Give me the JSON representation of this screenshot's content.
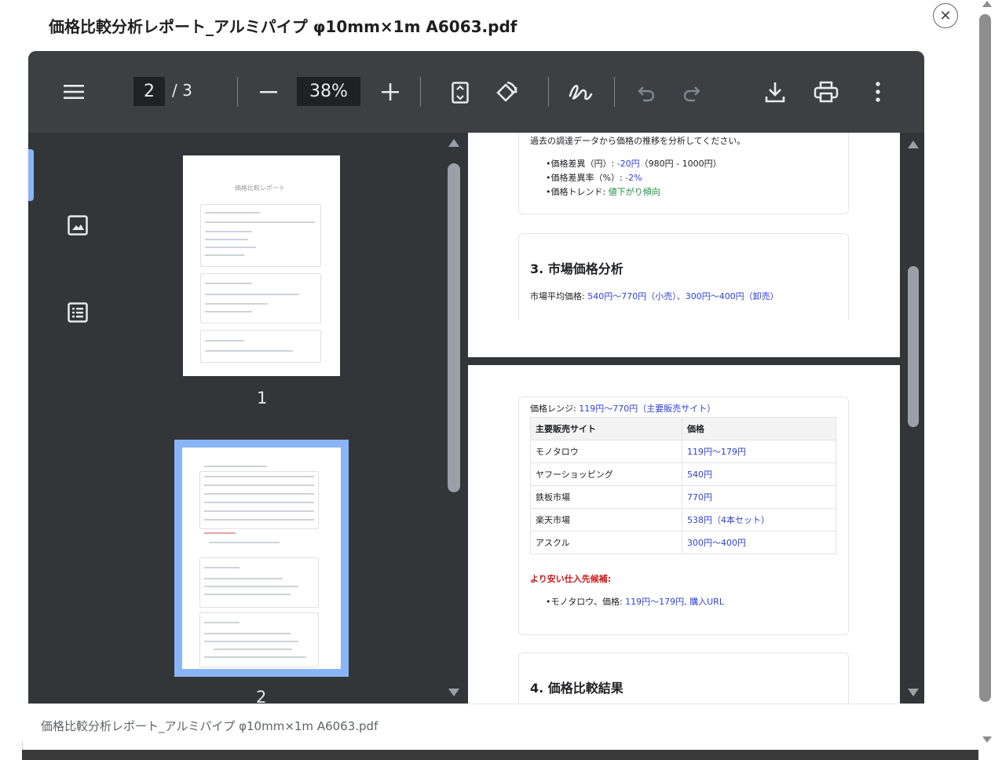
{
  "dialog": {
    "title": "価格比較分析レポート_アルミパイプ φ10mm×1m A6063.pdf",
    "close_glyph": "✕",
    "footer_filename": "価格比較分析レポート_アルミパイプ φ10mm×1m A6063.pdf"
  },
  "toolbar": {
    "current_page": "2",
    "page_total": "/ 3",
    "zoom": "38%",
    "icons": [
      "menu-icon",
      "zoom-out-icon",
      "zoom-in-icon",
      "fit-page-icon",
      "rotate-icon",
      "annotate-icon",
      "undo-icon",
      "redo-icon",
      "download-icon",
      "print-icon",
      "more-icon"
    ]
  },
  "sidebar": {
    "rail_icons": [
      "thumbnails-icon",
      "outline-icon"
    ],
    "thumb1_label": "1",
    "thumb2_label": "2",
    "thumb1_title": "価格比較レポート"
  },
  "document": {
    "trend_intro": "過去の調達データから価格の推移を分析してください。",
    "diff_yen_label": "•価格差異（円）: ",
    "diff_yen_value": "-20円",
    "diff_yen_rest": "（980円 - 1000円）",
    "diff_pct_label": "•価格差異率（%）: ",
    "diff_pct_value": "-2%",
    "trend_label": "•価格トレンド: ",
    "trend_value": "値下がり傾向",
    "market_heading": "3. 市場価格分析",
    "market_label": "市場平均価格: ",
    "market_value": "540円〜770円（小売）、300円〜400円（卸売）",
    "range_label": "価格レンジ: ",
    "range_value": "119円〜770円（主要販売サイト）",
    "table": {
      "headers": [
        "主要販売サイト",
        "価格"
      ],
      "rows": [
        [
          "モノタロウ",
          "119円〜179円"
        ],
        [
          "ヤフーショッピング",
          "540円"
        ],
        [
          "鉄板市場",
          "770円"
        ],
        [
          "楽天市場",
          "538円（4本セット）"
        ],
        [
          "アスクル",
          "300円〜400円"
        ]
      ]
    },
    "cheaper_label": "より安い仕入先候補:",
    "cheaper_item_prefix": "•モノタロウ、価格: ",
    "cheaper_item_price": "119円〜179円, 購入URL",
    "compare_heading": "4. 価格比較結果"
  },
  "colors": {
    "accent": "#8ab4f8",
    "toolbar": "#3c4043",
    "viewer": "#323639",
    "link_blue": "#2d41d8",
    "trend_green": "#1e8e3e",
    "warn_red": "#d01818"
  }
}
